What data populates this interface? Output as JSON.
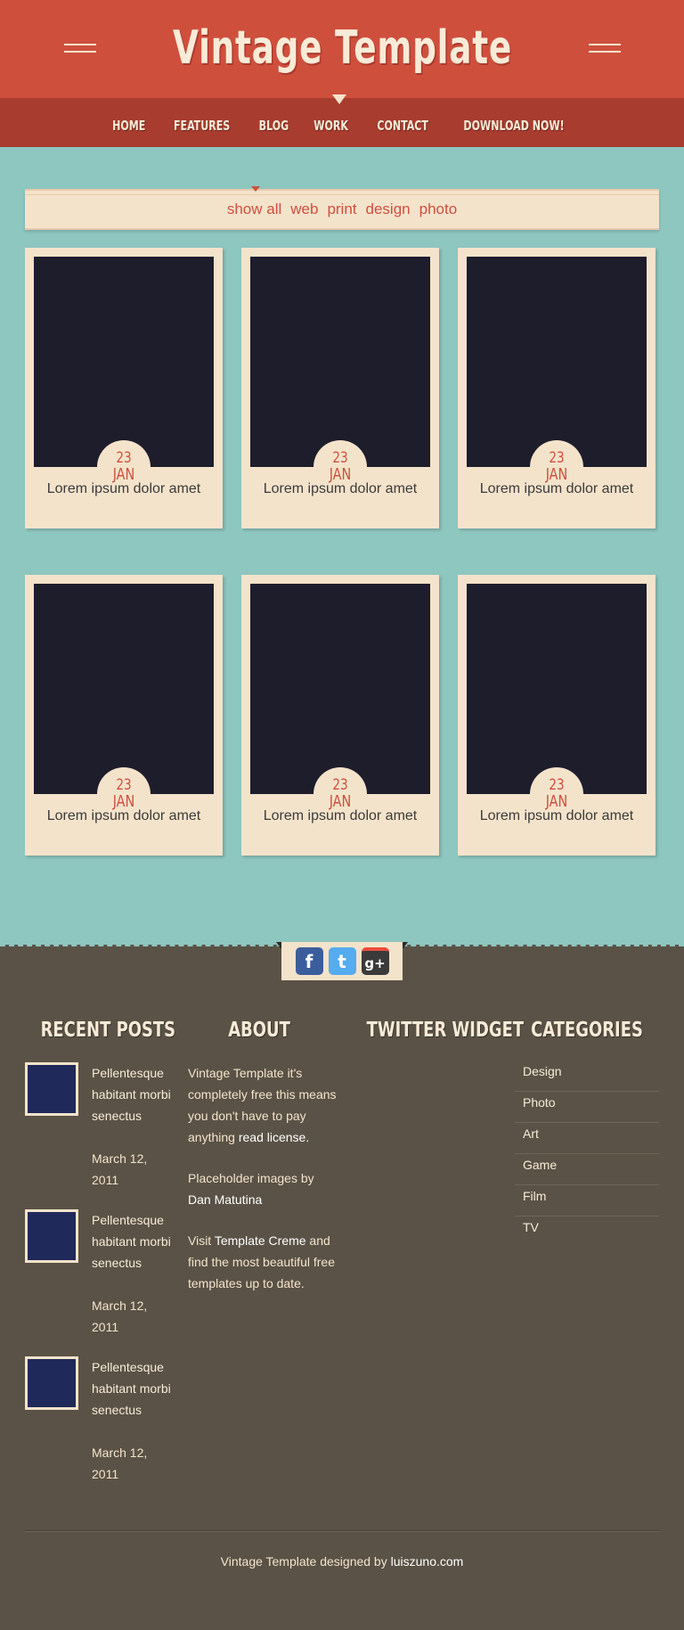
{
  "site": {
    "title": "Vintage Template"
  },
  "nav": {
    "items": [
      "Home",
      "Features",
      "Blog",
      "Work",
      "Contact",
      "Download Now!"
    ]
  },
  "filters": [
    "show all",
    "web",
    "print",
    "design",
    "photo"
  ],
  "cards": [
    {
      "day": "23",
      "month": "JAN",
      "caption": "Lorem ipsum dolor amet"
    },
    {
      "day": "23",
      "month": "JAN",
      "caption": "Lorem ipsum dolor amet"
    },
    {
      "day": "23",
      "month": "JAN",
      "caption": "Lorem ipsum dolor amet"
    },
    {
      "day": "23",
      "month": "JAN",
      "caption": "Lorem ipsum dolor amet"
    },
    {
      "day": "23",
      "month": "JAN",
      "caption": "Lorem ipsum dolor amet"
    },
    {
      "day": "23",
      "month": "JAN",
      "caption": "Lorem ipsum dolor amet"
    }
  ],
  "social": {
    "facebook": "f",
    "twitter": "t",
    "googleplus": "g+"
  },
  "footer": {
    "recent_posts": {
      "title": "Recent Posts",
      "posts": [
        {
          "title": "Pellentesque habitant morbi senectus",
          "date": "March 12, 2011"
        },
        {
          "title": "Pellentesque habitant morbi senectus",
          "date": "March 12, 2011"
        },
        {
          "title": "Pellentesque habitant morbi senectus",
          "date": "March 12, 2011"
        }
      ]
    },
    "about": {
      "title": "About",
      "p1": "Vintage Template it's completely free this means you don't have to pay anything ",
      "p1_link": "read license.",
      "p2": "Placeholder images by ",
      "p2_link": "Dan Matutina",
      "p3_pre": "Visit ",
      "p3_link": "Template Creme",
      "p3_post": " and find the most beautiful free templates up to date."
    },
    "twitter": {
      "title": "Twitter Widget"
    },
    "categories": {
      "title": "Categories",
      "items": [
        "Design",
        "Photo",
        "Art",
        "Game",
        "Film",
        "TV"
      ]
    },
    "credits": {
      "text": "Vintage Template designed by ",
      "link": "luiszuno.com"
    }
  },
  "colors": {
    "red": "#cf4f3d",
    "dark_red": "#a73c2f",
    "teal": "#8ec6c0",
    "cream": "#f4e3cb",
    "footer_bg": "#5a5246",
    "image_placeholder": "#1e1d2c",
    "post_thumb": "#1f2a5a"
  },
  "icons": [
    "facebook-icon",
    "twitter-icon",
    "googleplus-icon"
  ]
}
